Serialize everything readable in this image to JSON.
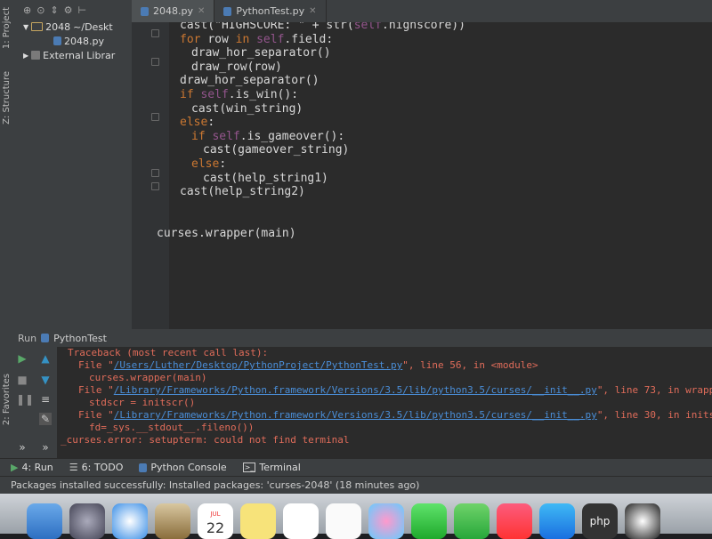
{
  "sidebar": {
    "project_tab": "1: Project",
    "structure_tab": "Z: Structure",
    "favorites_tab": "2: Favorites"
  },
  "project_tree": {
    "root": "2048",
    "root_path": "~/Deskt",
    "file": "2048.py",
    "external": "External Librar"
  },
  "tabs": [
    {
      "label": "2048.py",
      "active": true
    },
    {
      "label": "PythonTest.py",
      "active": false
    }
  ],
  "editor": {
    "lines": [
      {
        "text": "cast(\"HIGHSCORE: \" + str(self.highscore))",
        "indent": 4
      },
      {
        "text": "for row in self.field:",
        "indent": 4
      },
      {
        "text": "draw_hor_separator()",
        "indent": 6
      },
      {
        "text": "draw_row(row)",
        "indent": 6
      },
      {
        "text": "draw_hor_separator()",
        "indent": 4
      },
      {
        "text": "if self.is_win():",
        "indent": 4
      },
      {
        "text": "cast(win_string)",
        "indent": 6
      },
      {
        "text": "else:",
        "indent": 4
      },
      {
        "text": "if self.is_gameover():",
        "indent": 6
      },
      {
        "text": "cast(gameover_string)",
        "indent": 8
      },
      {
        "text": "else:",
        "indent": 6
      },
      {
        "text": "cast(help_string1)",
        "indent": 8
      },
      {
        "text": "cast(help_string2)",
        "indent": 4
      },
      {
        "text": "",
        "indent": 0
      },
      {
        "text": "",
        "indent": 0
      },
      {
        "text": "curses.wrapper(main)",
        "indent": 0
      }
    ]
  },
  "run": {
    "label": "Run",
    "config": "PythonTest"
  },
  "console": {
    "traceback": "Traceback (most recent call last):",
    "frame1_prefix": "File \"",
    "frame1_path": "/Users/Luther/Desktop/PythonProject/PythonTest.py",
    "frame1_suffix": "\", line 56, in <module>",
    "frame1_code": "curses.wrapper(main)",
    "frame2_prefix": "File \"",
    "frame2_path": "/Library/Frameworks/Python.framework/Versions/3.5/lib/python3.5/curses/__init__.py",
    "frame2_suffix": "\", line 73, in wrapper",
    "frame2_code": "stdscr = initscr()",
    "frame3_prefix": "File \"",
    "frame3_path": "/Library/Frameworks/Python.framework/Versions/3.5/lib/python3.5/curses/__init__.py",
    "frame3_suffix": "\", line 30, in initscr",
    "frame3_code": "fd=_sys.__stdout__.fileno())",
    "error": "_curses.error: setupterm: could not find terminal"
  },
  "bottom_tabs": [
    {
      "label": "4: Run"
    },
    {
      "label": "6: TODO"
    },
    {
      "label": "Python Console"
    },
    {
      "label": "Terminal"
    }
  ],
  "status": "Packages installed successfully: Installed packages: 'curses-2048' (18 minutes ago)",
  "dock": {
    "calendar_month": "JUL",
    "calendar_day": "22",
    "php_text": "php"
  },
  "colors": {
    "keyword": "#cc7832",
    "self": "#94558d",
    "error": "#e06c5a",
    "link": "#4a8ed8"
  }
}
